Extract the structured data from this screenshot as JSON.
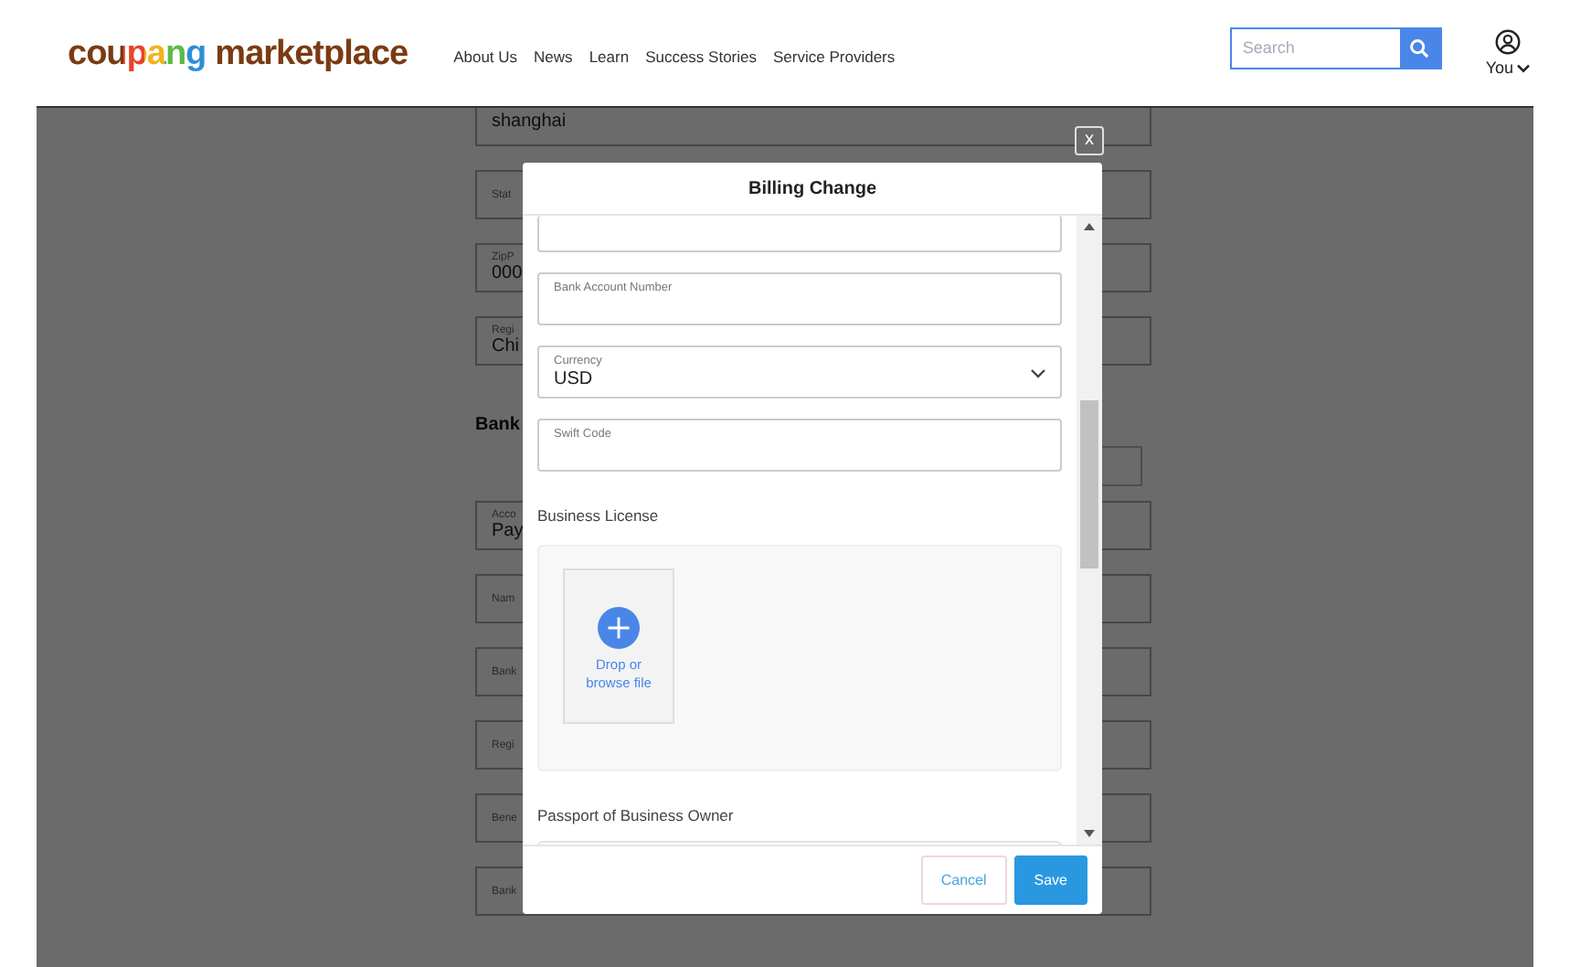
{
  "header": {
    "logo": {
      "brand": "coupang",
      "suffix": "marketplace"
    },
    "nav": [
      "About Us",
      "News",
      "Learn",
      "Success Stories",
      "Service Providers"
    ],
    "search": {
      "placeholder": "Search"
    },
    "user": {
      "label": "You"
    }
  },
  "background_form": {
    "fields": [
      {
        "value": "shanghai"
      },
      {
        "label": "Stat"
      },
      {
        "label": "ZipP",
        "value": "000"
      },
      {
        "label": "Regi",
        "value": "Chi"
      }
    ],
    "section_title": "Bank",
    "bank_fields": [
      {
        "label": "Acco",
        "value": "Pay"
      },
      {
        "label": "Nam"
      },
      {
        "label": "Bank"
      },
      {
        "label": "Regi"
      },
      {
        "label": "Bene"
      },
      {
        "label": "Bank"
      }
    ]
  },
  "modal": {
    "close": "x",
    "title": "Billing Change",
    "fields": [
      {
        "kind": "text",
        "label": "Bank Account Number"
      },
      {
        "kind": "select",
        "label": "Currency",
        "value": "USD"
      },
      {
        "kind": "text",
        "label": "Swift Code"
      }
    ],
    "uploads": [
      {
        "title": "Business License",
        "action": "Drop or browse file"
      },
      {
        "title": "Passport of Business Owner"
      }
    ],
    "buttons": [
      {
        "label": "Cancel",
        "kind": "secondary"
      },
      {
        "label": "Save",
        "kind": "primary"
      }
    ]
  }
}
